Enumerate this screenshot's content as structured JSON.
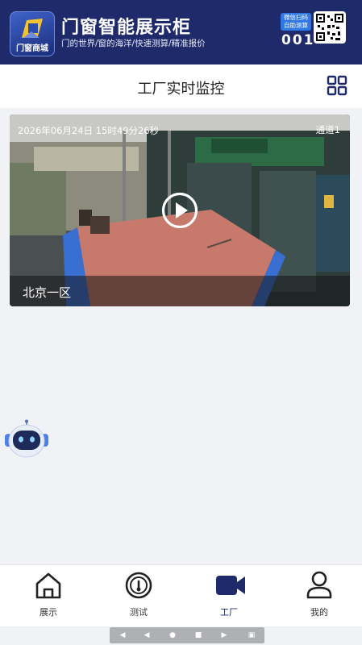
{
  "header": {
    "logo_text": "门窗商城",
    "title": "门窗智能展示柜",
    "subtitle": "门的世界/窗的海洋/快速测算/精准报价",
    "wechat_badge_line1": "微信扫码",
    "wechat_badge_line2": "自助测算",
    "store_number": "001",
    "icons": {
      "qr": "qr-code-icon"
    },
    "colors": {
      "header_bg": "#1f2a6b",
      "badge_bg": "#2f78e6"
    }
  },
  "page": {
    "title": "工厂实时监控",
    "grid_icon": "grid-view-icon"
  },
  "video": {
    "timestamp": "2026年06月24日 15时49分26秒",
    "channel": "通道1",
    "location_label": "北京一区",
    "play_icon": "play-icon"
  },
  "assistant": {
    "icon": "robot-assistant-icon"
  },
  "tabbar": {
    "tabs": [
      {
        "label": "展示",
        "icon": "home-icon",
        "active": false
      },
      {
        "label": "测试",
        "icon": "gauge-icon",
        "active": false
      },
      {
        "label": "工厂",
        "icon": "video-camera-icon",
        "active": true
      },
      {
        "label": "我的",
        "icon": "user-icon",
        "active": false
      }
    ],
    "active_color": "#1f2a6b"
  },
  "system_nav": {
    "icons": [
      "volume-down-icon",
      "back-icon",
      "home-dot-icon",
      "recents-icon",
      "volume-up-icon",
      "screenshot-icon"
    ]
  }
}
